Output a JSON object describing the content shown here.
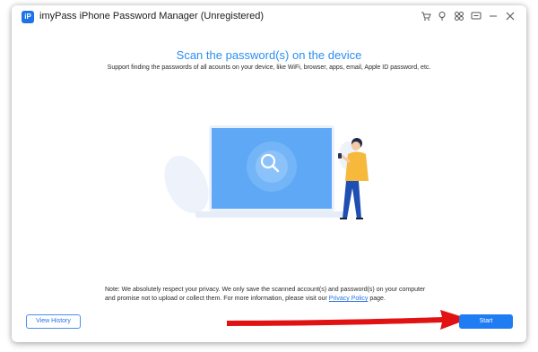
{
  "window": {
    "title": "imyPass iPhone Password Manager (Unregistered)",
    "logo_text": "iP",
    "toolbar_icons": [
      "cart-icon",
      "bulb-icon",
      "grid-icon",
      "message-icon",
      "minimize-icon",
      "close-icon"
    ]
  },
  "main": {
    "heading": "Scan the password(s) on the device",
    "subheading": "Support finding the passwords of all acounts on your device, like  WiFi, browser, apps, email, Apple ID password, etc."
  },
  "note": {
    "text": "Note: We absolutely respect your privacy. We only save the scanned account(s) and password(s) on your computer and promise not to upload or collect them. For more information, please visit our ",
    "link": "Privacy Policy",
    "suffix": " page."
  },
  "buttons": {
    "history": "View History",
    "start": "Start"
  },
  "colors": {
    "accent": "#2a8ef4",
    "primary_button": "#1f7cf2",
    "arrow": "#e11212",
    "screen": "#5ea8f6"
  }
}
